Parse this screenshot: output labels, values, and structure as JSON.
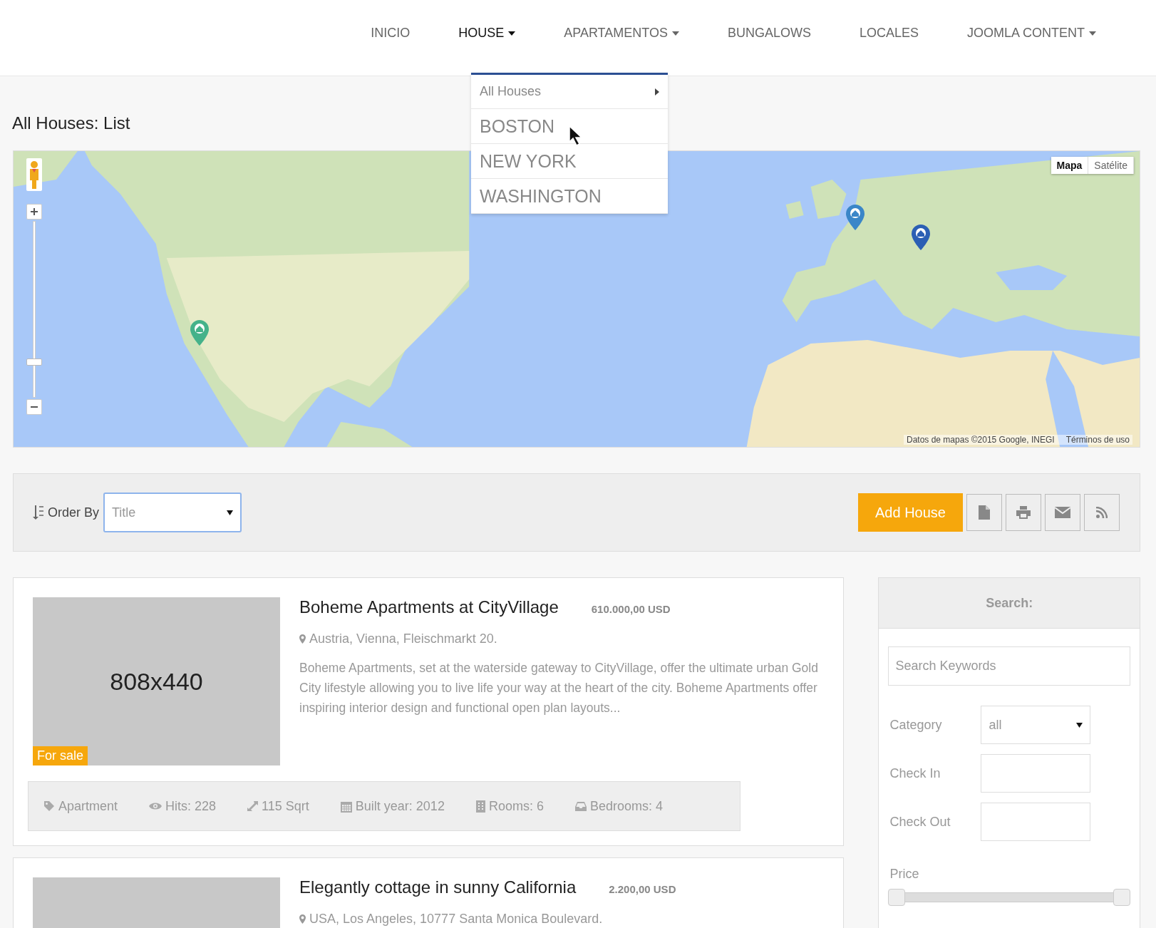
{
  "nav": [
    {
      "label": "INICIO",
      "selected": false,
      "has_submenu": false
    },
    {
      "label": "HOUSE",
      "selected": true,
      "has_submenu": true
    },
    {
      "label": "APARTAMENTOS",
      "selected": false,
      "has_submenu": true
    },
    {
      "label": "BUNGALOWS",
      "selected": false,
      "has_submenu": false
    },
    {
      "label": "LOCALES",
      "selected": false,
      "has_submenu": false
    },
    {
      "label": "JOOMLA CONTENT",
      "selected": false,
      "has_submenu": true
    }
  ],
  "dropdown": [
    {
      "label": "All Houses",
      "kind": "submenu"
    },
    {
      "label": "BOSTON",
      "kind": "city"
    },
    {
      "label": "NEW YORK",
      "kind": "city"
    },
    {
      "label": "WASHINGTON",
      "kind": "city"
    }
  ],
  "page_title": "All Houses: List",
  "map": {
    "kind": "picture",
    "map_types": [
      {
        "label": "Mapa",
        "selected": true
      },
      {
        "label": "Satélite",
        "selected": false
      }
    ],
    "zoom": {
      "level": 0.2
    },
    "attribution": "Datos de mapas ©2015 Google, INEGI",
    "terms": "Términos de uso",
    "pins": [
      {
        "color": "#45b28a"
      },
      {
        "color": "#3a86c8"
      },
      {
        "color": "#2b5fb4"
      }
    ]
  },
  "toolbar": {
    "order_label": "Order By",
    "order_value": "Title",
    "add_button": "Add House"
  },
  "listings": [
    {
      "title": "Boheme Apartments at CityVillage",
      "price": "610.000,00 USD",
      "address": "Austria, Vienna, Fleischmarkt 20.",
      "description": "Boheme Apartments, set at the waterside gateway to CityVillage, offer the ultimate urban Gold City lifestyle allowing you to live life your way at the heart of the city. Boheme Apartments offer inspiring interior design and functional open plan layouts...",
      "image_label": "808x440",
      "badge": "For sale",
      "features": [
        {
          "kind": "category",
          "text": "Apartment"
        },
        {
          "kind": "hits",
          "text": "Hits: 228"
        },
        {
          "kind": "area",
          "text": "115 Sqrt"
        },
        {
          "kind": "year",
          "text": "Built year: 2012"
        },
        {
          "kind": "rooms",
          "text": "Rooms: 6"
        },
        {
          "kind": "bedrooms",
          "text": "Bedrooms: 4"
        }
      ]
    },
    {
      "title": "Elegantly cottage in sunny California",
      "price": "2.200,00 USD",
      "address": "USA, Los Angeles, 10777 Santa Monica Boulevard."
    }
  ],
  "search": {
    "title": "Search:",
    "keywords_placeholder": "Search Keywords",
    "category_label": "Category",
    "category_value": "all",
    "check_in_label": "Check In",
    "check_out_label": "Check Out",
    "price_label": "Price",
    "price_slider": {
      "level": 1
    }
  }
}
